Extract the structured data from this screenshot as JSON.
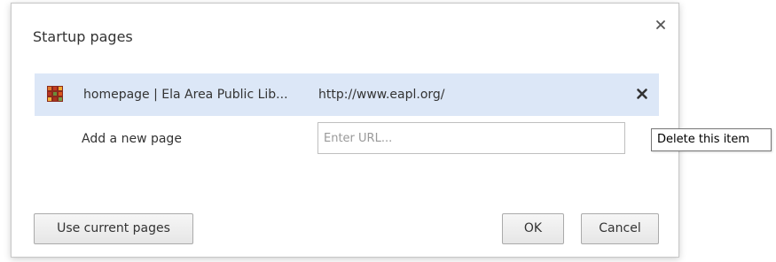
{
  "dialog": {
    "title": "Startup pages",
    "close_icon": "close-icon"
  },
  "pages": [
    {
      "favicon": "library-favicon-icon",
      "title": "homepage | Ela Area Public Lib...",
      "url": "http://www.eapl.org/",
      "delete_icon": "delete-x-icon"
    }
  ],
  "add_page": {
    "label": "Add a new page",
    "input_value": "",
    "input_placeholder": "Enter URL..."
  },
  "buttons": {
    "use_current": "Use current pages",
    "ok": "OK",
    "cancel": "Cancel"
  },
  "tooltip": {
    "text": "Delete this item"
  },
  "colors": {
    "row_highlight": "#dce7f7",
    "dialog_border": "#c8c8c8",
    "text": "#333333"
  }
}
